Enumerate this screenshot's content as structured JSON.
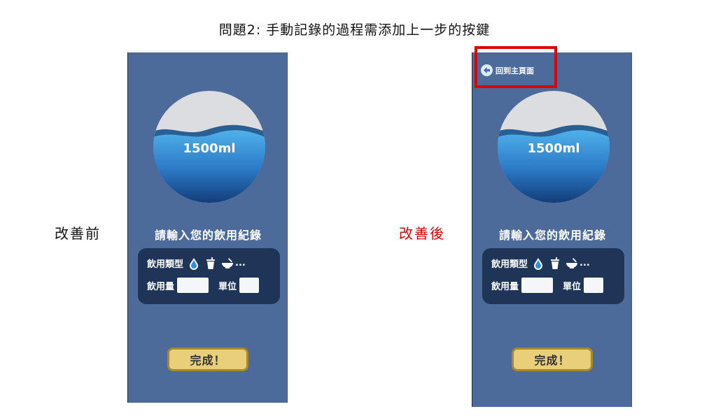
{
  "title": "問題2: 手動記錄的過程需添加上一步的按鍵",
  "labels": {
    "before": "改善前",
    "after": "改善後"
  },
  "colors": {
    "highlight": "#e00000",
    "phone_bg": "#4c6b9b",
    "card_bg": "#1f3558",
    "button_bg": "#e9cf7a"
  },
  "screens": {
    "before": {
      "water_amount": "1500ml",
      "record_title": "請輸入您的飲用紀錄",
      "type_label": "飲用類型",
      "type_icons": [
        "water-drop-icon",
        "cup-icon",
        "bowl-icon"
      ],
      "more_label": "...",
      "amount_label": "飲用量",
      "amount_value": "",
      "unit_label": "單位",
      "unit_value": "",
      "done_label": "完成！"
    },
    "after": {
      "back_label": "回到主頁面",
      "back_icon": "arrow-left-circle-icon",
      "water_amount": "1500ml",
      "record_title": "請輸入您的飲用紀錄",
      "type_label": "飲用類型",
      "type_icons": [
        "water-drop-icon",
        "cup-icon",
        "bowl-icon"
      ],
      "more_label": "...",
      "amount_label": "飲用量",
      "amount_value": "",
      "unit_label": "單位",
      "unit_value": "",
      "done_label": "完成！"
    }
  }
}
